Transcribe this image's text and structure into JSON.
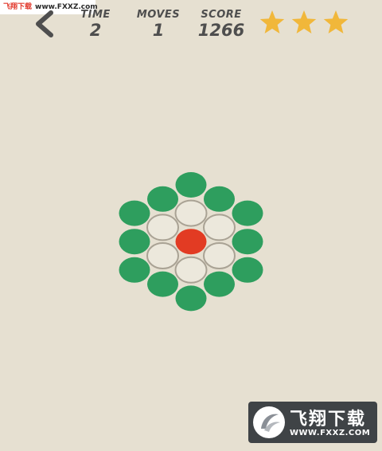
{
  "watermark": {
    "top_cn": "飞翔下载",
    "top_url": "www.FXXZ.com",
    "bottom_title": "飞翔下载",
    "bottom_site": "WWW.FXXZ.COM"
  },
  "hud": {
    "time_label": "TIME",
    "time_value": "2",
    "moves_label": "MOVES",
    "moves_value": "1",
    "score_label": "SCORE",
    "score_value": "1266",
    "stars_earned": 3,
    "stars_total": 3
  },
  "colors": {
    "background": "#e6e0d1",
    "filled_peg": "#2e9e5e",
    "empty_slot_fill": "#ece8dc",
    "empty_slot_stroke": "#a9a294",
    "selected_peg": "#e23b23",
    "star": "#f1b73a",
    "hud_text": "#4e4e4e"
  },
  "board": {
    "pieces": [
      {
        "row": 0,
        "col": 0,
        "state": "filled"
      },
      {
        "row": 1,
        "col": -1,
        "state": "filled"
      },
      {
        "row": 1,
        "col": 1,
        "state": "filled"
      },
      {
        "row": 2,
        "col": -2,
        "state": "filled"
      },
      {
        "row": 2,
        "col": 0,
        "state": "empty"
      },
      {
        "row": 2,
        "col": 2,
        "state": "filled"
      },
      {
        "row": 3,
        "col": -1,
        "state": "empty"
      },
      {
        "row": 3,
        "col": 1,
        "state": "empty"
      },
      {
        "row": 4,
        "col": -2,
        "state": "filled"
      },
      {
        "row": 4,
        "col": 0,
        "state": "selected"
      },
      {
        "row": 4,
        "col": 2,
        "state": "filled"
      },
      {
        "row": 5,
        "col": -1,
        "state": "empty"
      },
      {
        "row": 5,
        "col": 1,
        "state": "empty"
      },
      {
        "row": 6,
        "col": -2,
        "state": "filled"
      },
      {
        "row": 6,
        "col": 0,
        "state": "empty"
      },
      {
        "row": 6,
        "col": 2,
        "state": "filled"
      },
      {
        "row": 7,
        "col": -1,
        "state": "filled"
      },
      {
        "row": 7,
        "col": 1,
        "state": "filled"
      },
      {
        "row": 8,
        "col": 0,
        "state": "filled"
      }
    ]
  }
}
